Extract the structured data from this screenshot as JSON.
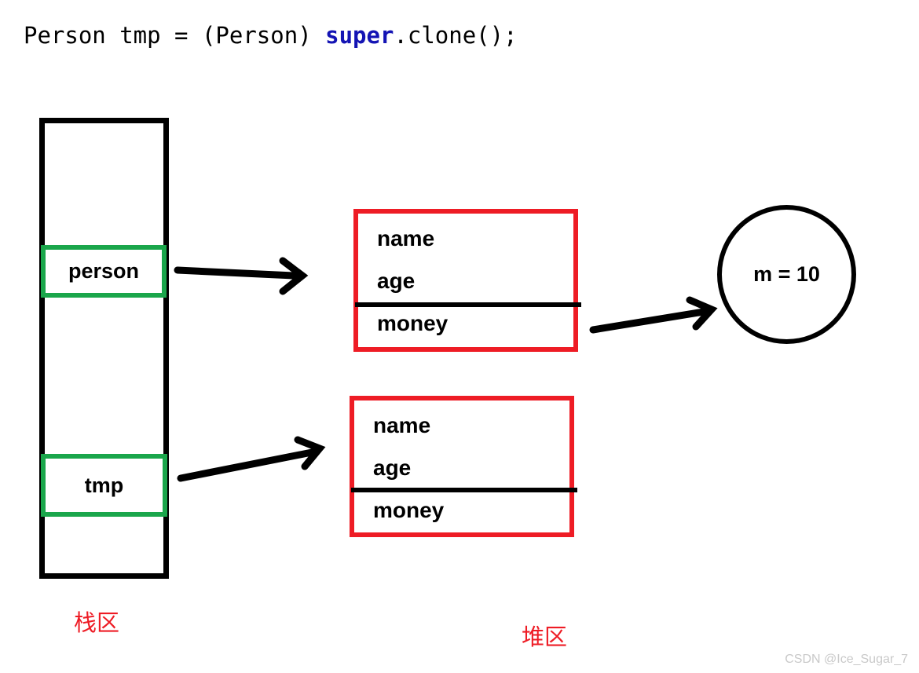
{
  "code": {
    "prefix": "Person tmp = (Person) ",
    "keyword": "super",
    "suffix": ".clone();"
  },
  "stack": {
    "region_label": "栈区",
    "slots": [
      {
        "label": "person"
      },
      {
        "label": "tmp"
      }
    ]
  },
  "heap": {
    "region_label": "堆区",
    "objects": [
      {
        "fields_top": [
          "name",
          "age"
        ],
        "fields_bottom": [
          "money"
        ]
      },
      {
        "fields_top": [
          "name",
          "age"
        ],
        "fields_bottom": [
          "money"
        ]
      }
    ],
    "member_circle": {
      "label": "m = 10"
    }
  },
  "colors": {
    "stack_border": "#000000",
    "slot_border": "#1aa64b",
    "heap_border": "#ee1c25",
    "region_label": "#ee1c25",
    "keyword": "#1414b4",
    "watermark": "#c9c9c9"
  },
  "arrows": [
    {
      "name": "person-to-object-1"
    },
    {
      "name": "tmp-to-object-2"
    },
    {
      "name": "money-to-member"
    }
  ],
  "watermark": {
    "text": "CSDN @Ice_Sugar_7"
  }
}
